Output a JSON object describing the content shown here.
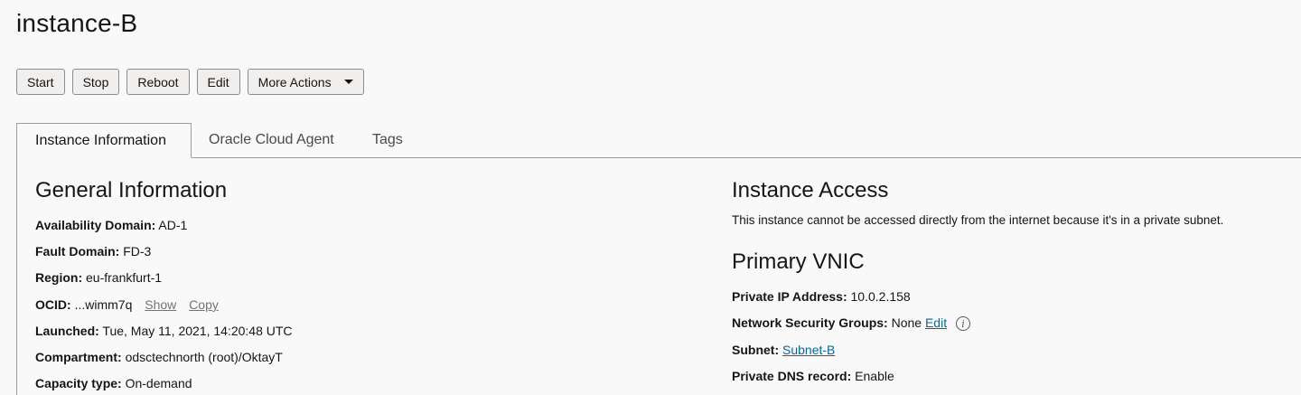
{
  "page": {
    "title": "instance-B"
  },
  "toolbar": {
    "start": "Start",
    "stop": "Stop",
    "reboot": "Reboot",
    "edit": "Edit",
    "more_actions": "More Actions"
  },
  "tabs": [
    {
      "label": "Instance Information",
      "active": true
    },
    {
      "label": "Oracle Cloud Agent",
      "active": false
    },
    {
      "label": "Tags",
      "active": false
    }
  ],
  "general": {
    "heading": "General Information",
    "availability_domain": {
      "label": "Availability Domain:",
      "value": "AD-1"
    },
    "fault_domain": {
      "label": "Fault Domain:",
      "value": "FD-3"
    },
    "region": {
      "label": "Region:",
      "value": "eu-frankfurt-1"
    },
    "ocid": {
      "label": "OCID:",
      "value": "...wimm7q",
      "show": "Show",
      "copy": "Copy"
    },
    "launched": {
      "label": "Launched:",
      "value": "Tue, May 11, 2021, 14:20:48 UTC"
    },
    "compartment": {
      "label": "Compartment:",
      "value": "odsctechnorth (root)/OktayT"
    },
    "capacity_type": {
      "label": "Capacity type:",
      "value": "On-demand"
    }
  },
  "access": {
    "heading": "Instance Access",
    "message": "This instance cannot be accessed directly from the internet because it's in a private subnet."
  },
  "vnic": {
    "heading": "Primary VNIC",
    "private_ip": {
      "label": "Private IP Address:",
      "value": "10.0.2.158"
    },
    "nsg": {
      "label": "Network Security Groups:",
      "value": "None",
      "edit": "Edit",
      "info_icon": "info-icon"
    },
    "subnet": {
      "label": "Subnet:",
      "value": "Subnet-B"
    },
    "dns": {
      "label": "Private DNS record:",
      "value": "Enable"
    }
  }
}
